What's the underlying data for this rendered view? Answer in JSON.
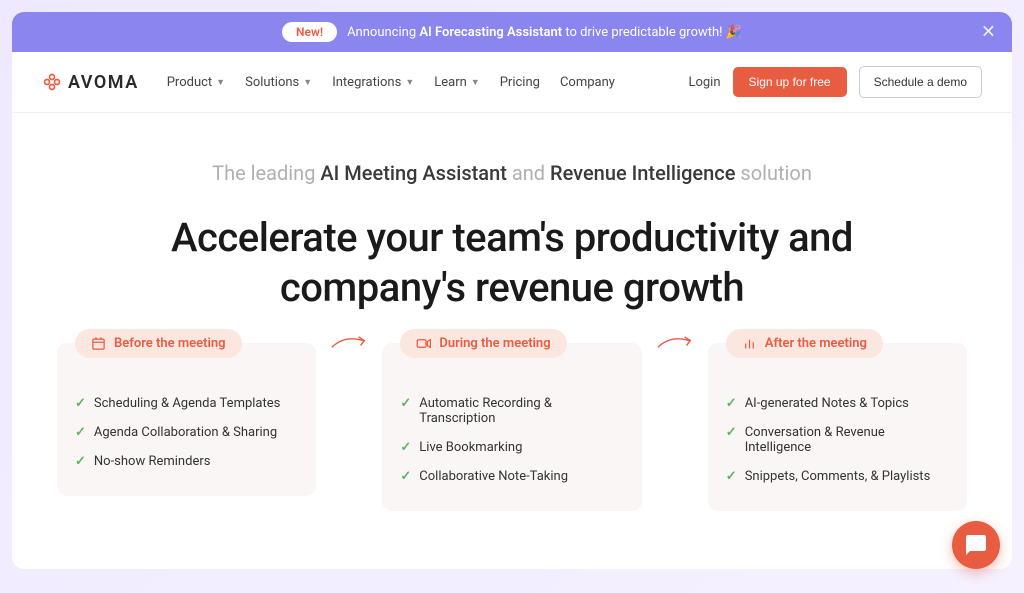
{
  "banner": {
    "pill": "New!",
    "prefix": "Announcing ",
    "bold": "AI Forecasting Assistant",
    "suffix": " to drive predictable growth! 🎉"
  },
  "logo": {
    "text": "AVOMA"
  },
  "nav": {
    "items": [
      {
        "label": "Product",
        "hasDropdown": true
      },
      {
        "label": "Solutions",
        "hasDropdown": true
      },
      {
        "label": "Integrations",
        "hasDropdown": true
      },
      {
        "label": "Learn",
        "hasDropdown": true
      },
      {
        "label": "Pricing",
        "hasDropdown": false
      },
      {
        "label": "Company",
        "hasDropdown": false
      }
    ],
    "login": "Login",
    "signup": "Sign up for free",
    "demo": "Schedule a demo"
  },
  "hero": {
    "sub_pre": "The leading ",
    "sub_b1": "AI Meeting Assistant",
    "sub_mid": " and ",
    "sub_b2": "Revenue Intelligence",
    "sub_end": " solution",
    "headline_l1": "Accelerate your team's productivity and",
    "headline_l2": "company's revenue growth"
  },
  "features": [
    {
      "title": "Before the meeting",
      "items": [
        "Scheduling & Agenda Templates",
        "Agenda Collaboration & Sharing",
        "No-show Reminders"
      ]
    },
    {
      "title": "During the meeting",
      "items": [
        "Automatic Recording & Transcription",
        "Live Bookmarking",
        "Collaborative Note-Taking"
      ]
    },
    {
      "title": "After the meeting",
      "items": [
        "AI-generated Notes & Topics",
        "Conversation & Revenue Intelligence",
        "Snippets, Comments, & Playlists"
      ]
    }
  ]
}
